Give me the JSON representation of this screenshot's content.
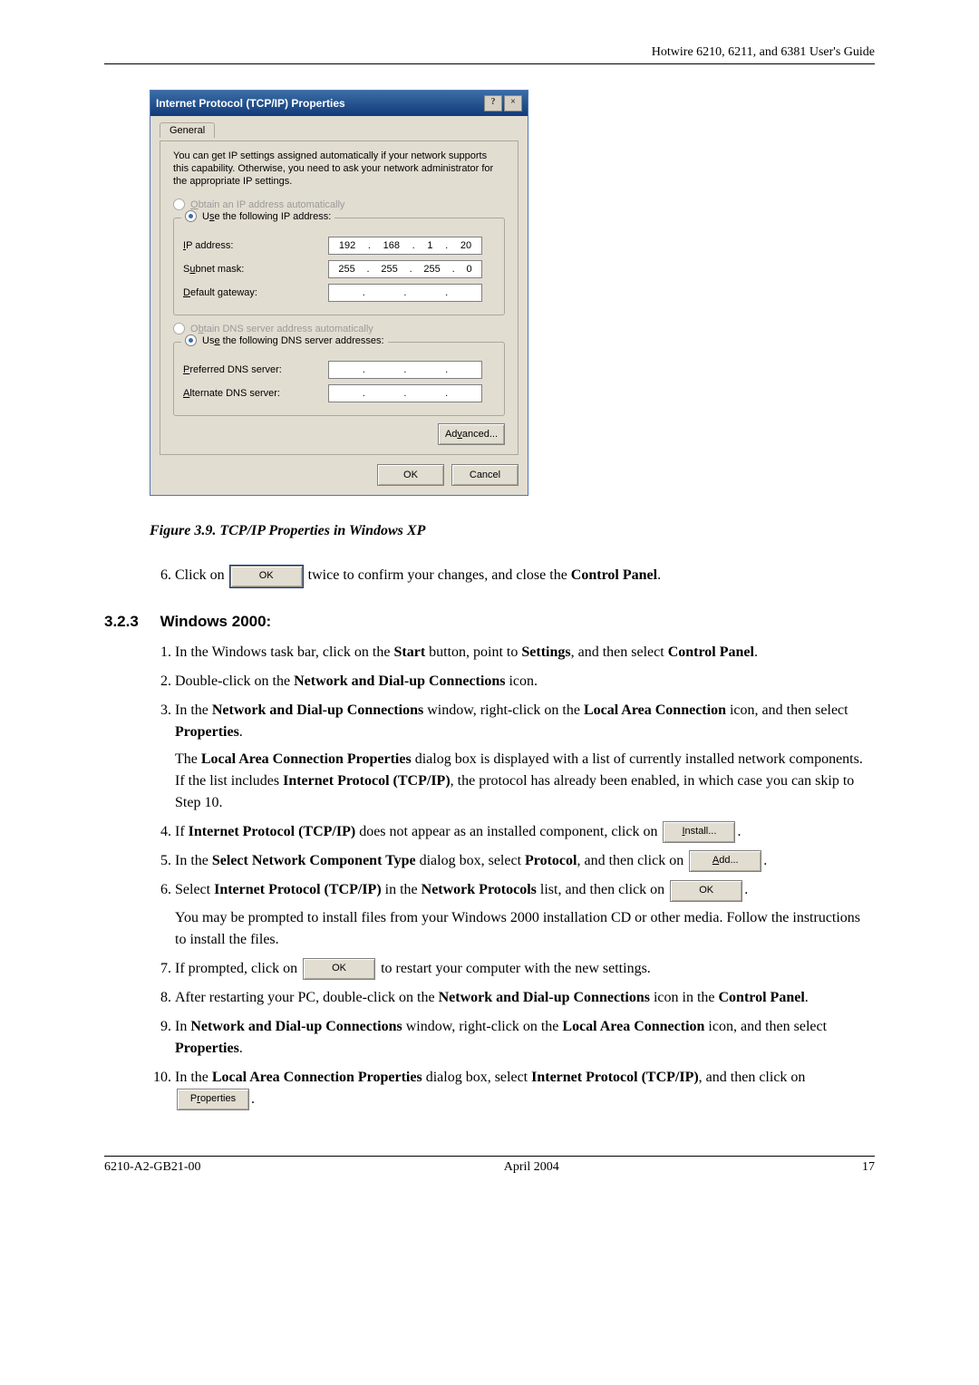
{
  "header": {
    "right": "Hotwire 6210, 6211, and 6381 User's Guide"
  },
  "dialog": {
    "title": "Internet Protocol (TCP/IP) Properties",
    "help_btn": "?",
    "close_btn": "×",
    "tab_label": "General",
    "explanation": "You can get IP settings assigned automatically if your network supports this capability. Otherwise, you need to ask your network administrator for the appropriate IP settings.",
    "radio_obtain_ip": "Obtain an IP address automatically",
    "radio_use_ip": "Use the following IP address:",
    "ip_label": "IP address:",
    "ip_value": {
      "o1": "192",
      "o2": "168",
      "o3": "1",
      "o4": "20"
    },
    "subnet_label": "Subnet mask:",
    "subnet_value": {
      "o1": "255",
      "o2": "255",
      "o3": "255",
      "o4": "0"
    },
    "gateway_label": "Default gateway:",
    "radio_obtain_dns": "Obtain DNS server address automatically",
    "radio_use_dns": "Use the following DNS server addresses:",
    "pref_dns_label": "Preferred DNS server:",
    "alt_dns_label": "Alternate DNS server:",
    "advanced_btn": "Advanced...",
    "ok_btn": "OK",
    "cancel_btn": "Cancel"
  },
  "figure_caption": "Figure 3.9. TCP/IP Properties in Windows XP",
  "step6_before": "Click on ",
  "step6_ok": "OK",
  "step6_after": " twice to confirm your changes, and close the ",
  "step6_bold": "Control Panel",
  "step6_period": ".",
  "section": {
    "num": "3.2.3",
    "title": "Windows 2000:"
  },
  "win2000_steps": {
    "s1": {
      "pre": "In the Windows task bar, click on the ",
      "b1": "Start",
      "mid1": " button, point to ",
      "b2": "Settings",
      "mid2": ", and then select ",
      "b3": "Control Panel",
      "post": "."
    },
    "s2": {
      "pre": "Double-click on the ",
      "b1": "Network and Dial-up Connections",
      "post": " icon."
    },
    "s3": {
      "pre": "In the ",
      "b1": "Network and Dial-up Connections",
      "mid1": " window, right-click on the ",
      "b2": "Local Area Connection",
      "mid2": " icon, and then select ",
      "b3": "Properties",
      "post": "."
    },
    "s3_para": {
      "pre": "The ",
      "b1": "Local Area Connection Properties",
      "mid1": " dialog box is displayed with a list of currently installed network components. If the list includes ",
      "b2": "Internet Protocol (TCP/IP)",
      "post": ", the protocol has already been enabled, in which case you can skip to Step 10."
    },
    "s4": {
      "pre": "If ",
      "b1": "Internet Protocol (TCP/IP)",
      "post": " does not appear as an installed component, click on ",
      "btn": "Install...",
      "period": "."
    },
    "s5": {
      "pre": "In the ",
      "b1": "Select Network Component Type",
      "mid1": " dialog box, select ",
      "b2": "Protocol",
      "post": ", and then click on ",
      "btn": "Add...",
      "period": "."
    },
    "s6": {
      "pre": "Select ",
      "b1": "Internet Protocol (TCP/IP)",
      "mid1": " in the ",
      "b2": "Network Protocols",
      "post": " list, and then click on ",
      "btn": "OK",
      "period": "."
    },
    "s6_para": "You may be prompted to install files from your Windows 2000 installation CD or other media. Follow the instructions to install the files.",
    "s7": {
      "pre": "If prompted, click on ",
      "btn": "OK",
      "post": " to restart your computer with the new settings."
    },
    "s8": {
      "pre": "After restarting your PC, double-click on the ",
      "b1": "Network and Dial-up Connections",
      "mid1": " icon in the ",
      "b2": "Control Panel",
      "post": "."
    },
    "s9": {
      "pre": "In ",
      "b1": "Network and Dial-up Connections",
      "mid1": " window, right-click on the ",
      "b2": "Local Area Connection",
      "mid2": " icon, and then select ",
      "b3": "Properties",
      "post": "."
    },
    "s10": {
      "pre": "In the ",
      "b1": "Local Area Connection Properties",
      "mid1": " dialog box, select ",
      "b2": "Internet Protocol (TCP/IP)",
      "post": ", and then click on ",
      "btn": "Properties",
      "period": "."
    }
  },
  "footer": {
    "left": "6210-A2-GB21-00",
    "center": "April 2004",
    "right": "17"
  }
}
